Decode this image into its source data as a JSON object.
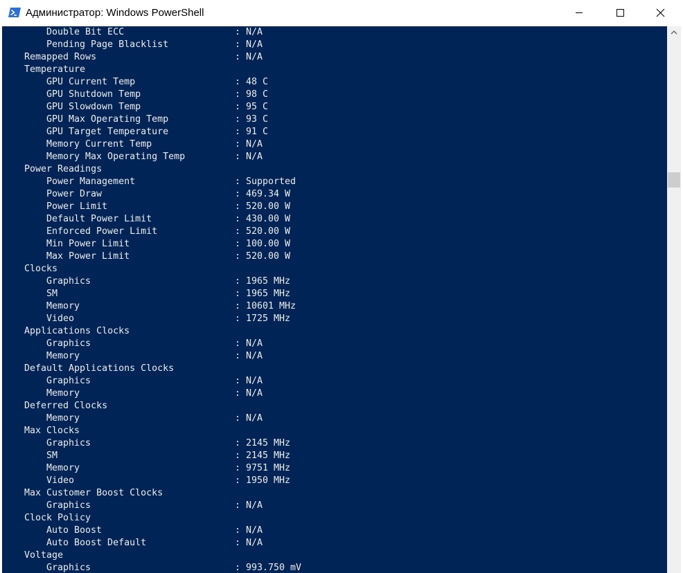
{
  "window": {
    "title": "Администратор: Windows PowerShell",
    "icon": "powershell-icon",
    "buttons": {
      "minimize": "minimize-icon",
      "maximize": "maximize-icon",
      "close": "close-icon"
    }
  },
  "colors": {
    "console_background": "#012456",
    "console_text": "#eeedf0",
    "scrollbar_track": "#f0f0f0",
    "scrollbar_thumb": "#cdcdcd"
  },
  "console": {
    "lines": [
      {
        "kind": "sub",
        "label": "Double Bit ECC",
        "value": ": N/A"
      },
      {
        "kind": "sub",
        "label": "Pending Page Blacklist",
        "value": ": N/A"
      },
      {
        "kind": "cat",
        "label": "Remapped Rows",
        "value": ": N/A"
      },
      {
        "kind": "cat",
        "label": "Temperature",
        "value": ""
      },
      {
        "kind": "sub",
        "label": "GPU Current Temp",
        "value": ": 48 C"
      },
      {
        "kind": "sub",
        "label": "GPU Shutdown Temp",
        "value": ": 98 C"
      },
      {
        "kind": "sub",
        "label": "GPU Slowdown Temp",
        "value": ": 95 C"
      },
      {
        "kind": "sub",
        "label": "GPU Max Operating Temp",
        "value": ": 93 C"
      },
      {
        "kind": "sub",
        "label": "GPU Target Temperature",
        "value": ": 91 C"
      },
      {
        "kind": "sub",
        "label": "Memory Current Temp",
        "value": ": N/A"
      },
      {
        "kind": "sub",
        "label": "Memory Max Operating Temp",
        "value": ": N/A"
      },
      {
        "kind": "cat",
        "label": "Power Readings",
        "value": ""
      },
      {
        "kind": "sub",
        "label": "Power Management",
        "value": ": Supported"
      },
      {
        "kind": "sub",
        "label": "Power Draw",
        "value": ": 469.34 W"
      },
      {
        "kind": "sub",
        "label": "Power Limit",
        "value": ": 520.00 W"
      },
      {
        "kind": "sub",
        "label": "Default Power Limit",
        "value": ": 430.00 W"
      },
      {
        "kind": "sub",
        "label": "Enforced Power Limit",
        "value": ": 520.00 W"
      },
      {
        "kind": "sub",
        "label": "Min Power Limit",
        "value": ": 100.00 W"
      },
      {
        "kind": "sub",
        "label": "Max Power Limit",
        "value": ": 520.00 W"
      },
      {
        "kind": "cat",
        "label": "Clocks",
        "value": ""
      },
      {
        "kind": "sub",
        "label": "Graphics",
        "value": ": 1965 MHz"
      },
      {
        "kind": "sub",
        "label": "SM",
        "value": ": 1965 MHz"
      },
      {
        "kind": "sub",
        "label": "Memory",
        "value": ": 10601 MHz"
      },
      {
        "kind": "sub",
        "label": "Video",
        "value": ": 1725 MHz"
      },
      {
        "kind": "cat",
        "label": "Applications Clocks",
        "value": ""
      },
      {
        "kind": "sub",
        "label": "Graphics",
        "value": ": N/A"
      },
      {
        "kind": "sub",
        "label": "Memory",
        "value": ": N/A"
      },
      {
        "kind": "cat",
        "label": "Default Applications Clocks",
        "value": ""
      },
      {
        "kind": "sub",
        "label": "Graphics",
        "value": ": N/A"
      },
      {
        "kind": "sub",
        "label": "Memory",
        "value": ": N/A"
      },
      {
        "kind": "cat",
        "label": "Deferred Clocks",
        "value": ""
      },
      {
        "kind": "sub",
        "label": "Memory",
        "value": ": N/A"
      },
      {
        "kind": "cat",
        "label": "Max Clocks",
        "value": ""
      },
      {
        "kind": "sub",
        "label": "Graphics",
        "value": ": 2145 MHz"
      },
      {
        "kind": "sub",
        "label": "SM",
        "value": ": 2145 MHz"
      },
      {
        "kind": "sub",
        "label": "Memory",
        "value": ": 9751 MHz"
      },
      {
        "kind": "sub",
        "label": "Video",
        "value": ": 1950 MHz"
      },
      {
        "kind": "cat",
        "label": "Max Customer Boost Clocks",
        "value": ""
      },
      {
        "kind": "sub",
        "label": "Graphics",
        "value": ": N/A"
      },
      {
        "kind": "cat",
        "label": "Clock Policy",
        "value": ""
      },
      {
        "kind": "sub",
        "label": "Auto Boost",
        "value": ": N/A"
      },
      {
        "kind": "sub",
        "label": "Auto Boost Default",
        "value": ": N/A"
      },
      {
        "kind": "cat",
        "label": "Voltage",
        "value": ""
      },
      {
        "kind": "sub",
        "label": "Graphics",
        "value": ": 993.750 mV"
      }
    ]
  },
  "scrollbar": {
    "up_arrow": "scroll-up-arrow-icon"
  }
}
